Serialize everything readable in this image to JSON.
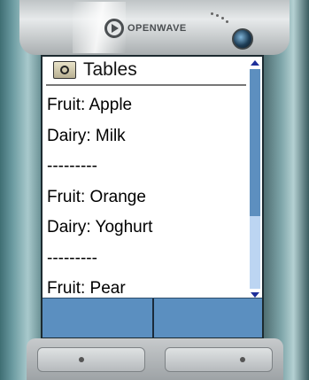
{
  "header": {
    "brand_text": "OPENWAVE",
    "brand_icon": "openwave-logo-icon"
  },
  "screen": {
    "title": "Tables",
    "title_icon": "deck-icon",
    "lines": [
      "Fruit: Apple",
      "Dairy: Milk",
      "---------",
      "Fruit: Orange",
      "Dairy: Yoghurt",
      "---------",
      "Fruit: Pear"
    ],
    "scrollbar": {
      "up_icon": "scroll-up-arrow-icon",
      "down_icon": "scroll-down-arrow-icon"
    },
    "softkeys": {
      "left_label": "",
      "right_label": ""
    }
  },
  "colors": {
    "softkey_bar": "#5b8fc0",
    "scroll_thumb": "#5d8fbf",
    "scroll_track": "#bcd5f2",
    "scroll_arrows": "#1e2f9a",
    "phone_casing": "#6a9aa0"
  }
}
